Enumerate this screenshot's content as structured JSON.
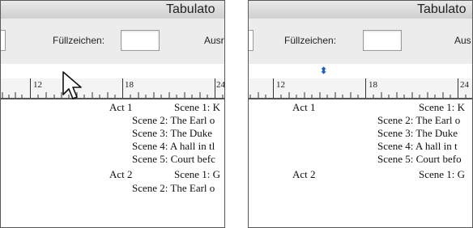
{
  "left": {
    "title": "Tabulato",
    "fill_label": "Füllzeichen:",
    "fill_value": "",
    "align_label": "Ausr",
    "ruler": [
      "12",
      "18",
      "24"
    ],
    "doc": [
      {
        "left": "Act 1",
        "right": "Scene 1: K"
      },
      {
        "left": "",
        "right": "Scene 2: The Earl o"
      },
      {
        "left": "",
        "right": "Scene 3: The Duke"
      },
      {
        "left": "",
        "right": "Scene 4: A hall in tl"
      },
      {
        "left": "",
        "right": "Scene 5: Court befc"
      },
      {
        "left": "Act 2",
        "right": "Scene 1: G"
      },
      {
        "left": "",
        "right": "Scene 2: The Earl o"
      }
    ]
  },
  "right": {
    "title": "Tabulato",
    "fill_label": "Füllzeichen:",
    "fill_value": "",
    "align_label": "Aus",
    "ruler": [
      "12",
      "18",
      "24"
    ],
    "doc": [
      {
        "left": "Act 1",
        "right": "Scene 1: K"
      },
      {
        "left": "",
        "right": "Scene 2: The Earl o"
      },
      {
        "left": "",
        "right": "Scene 3: The Duke"
      },
      {
        "left": "",
        "right": "Scene 4: A hall in t"
      },
      {
        "left": "",
        "right": "Scene 5: Court befo"
      },
      {
        "left": "Act 2",
        "right": "Scene 1: G"
      }
    ]
  },
  "icons": {
    "cursor": "arrow-pointer-icon",
    "tab_stop": "tab-stop-marker-icon"
  },
  "colors": {
    "chrome": "#ececec",
    "tab_marker": "#1e5fb4"
  }
}
